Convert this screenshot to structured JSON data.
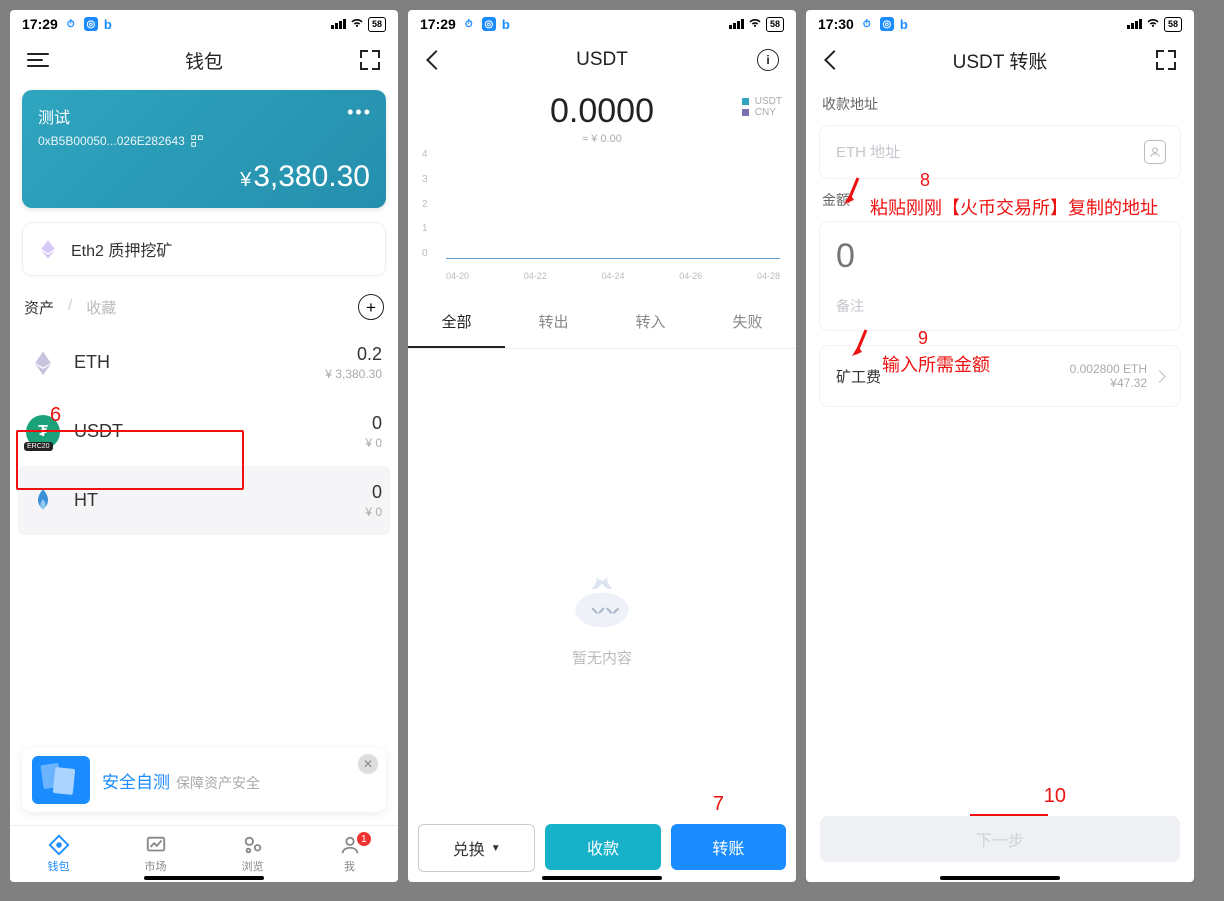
{
  "phone1": {
    "time": "17:29",
    "battery": "58",
    "header_title": "钱包",
    "wallet": {
      "name": "测试",
      "address": "0xB5B00050...026E282643",
      "balance": "3,380.30",
      "currency": "¥"
    },
    "stake_label": "Eth2 质押挖矿",
    "tabs": {
      "assets": "资产",
      "fav": "收藏"
    },
    "assets": [
      {
        "symbol": "ETH",
        "amount": "0.2",
        "fiat": "¥ 3,380.30"
      },
      {
        "symbol": "USDT",
        "amount": "0",
        "fiat": "¥ 0"
      },
      {
        "symbol": "HT",
        "amount": "0",
        "fiat": "¥ 0"
      }
    ],
    "promo": {
      "title": "安全自测",
      "subtitle": "保障资产安全"
    },
    "nav": {
      "wallet": "钱包",
      "market": "市场",
      "browse": "浏览",
      "me": "我",
      "badge": "1"
    },
    "annotation6": "6"
  },
  "phone2": {
    "time": "17:29",
    "battery": "58",
    "header_title": "USDT",
    "balance": "0.0000",
    "balance_fiat": "≈ ¥ 0.00",
    "legend": {
      "a": "USDT",
      "b": "CNY"
    },
    "tx_tabs": {
      "all": "全部",
      "out": "转出",
      "in": "转入",
      "fail": "失败"
    },
    "empty_text": "暂无内容",
    "actions": {
      "swap": "兑换",
      "receive": "收款",
      "transfer": "转账"
    },
    "annotation7": "7"
  },
  "phone3": {
    "time": "17:30",
    "battery": "58",
    "header_title": "USDT 转账",
    "recv_label": "收款地址",
    "addr_placeholder": "ETH 地址",
    "amount_label": "金额",
    "amount_placeholder": "0",
    "memo_placeholder": "备注",
    "fee_label": "矿工费",
    "fee_eth": "0.002800 ETH",
    "fee_cny": "¥47.32",
    "next_label": "下一步",
    "ann8_num": "8",
    "ann8_text": "粘贴刚刚【火币交易所】复制的地址",
    "ann9_num": "9",
    "ann9_text": "输入所需金额",
    "ann10_num": "10"
  },
  "chart_data": {
    "type": "line",
    "x": [
      "04-20",
      "04-22",
      "04-24",
      "04-26",
      "04-28"
    ],
    "series": [
      {
        "name": "USDT",
        "values": [
          0,
          0,
          0,
          0,
          0
        ]
      },
      {
        "name": "CNY",
        "values": [
          0,
          0,
          0,
          0,
          0
        ]
      }
    ],
    "y_ticks": [
      4,
      3,
      2,
      1,
      0
    ],
    "ylim": [
      0,
      4
    ],
    "xlabel": "",
    "ylabel": ""
  }
}
